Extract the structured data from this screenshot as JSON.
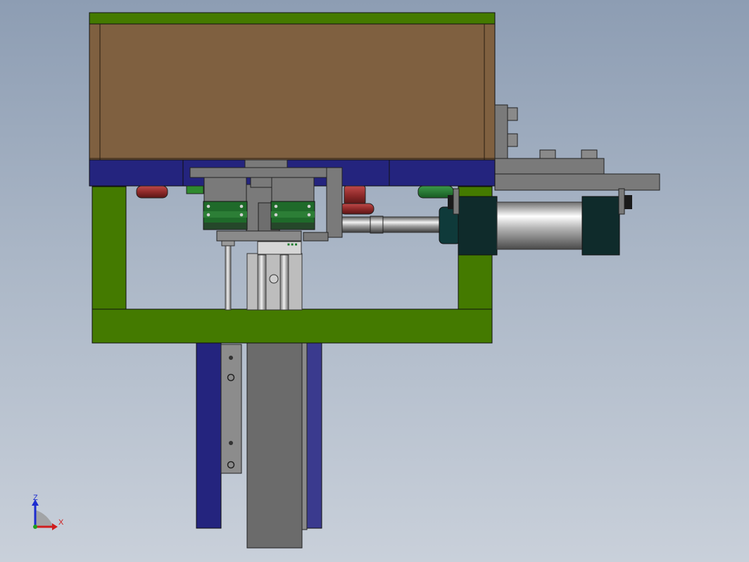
{
  "viewport": {
    "background_top": "#8d9db3",
    "background_bottom": "#c9d0da"
  },
  "colors": {
    "wood_plate": "#7f6040",
    "green_frame": "#447a00",
    "blue_plate": "#24247e",
    "gray_part": "#6b6b6b",
    "dark_teal": "#0f2b2b",
    "red_part": "#8f2a2a",
    "green_block": "#1f6a2a"
  },
  "triad": {
    "z_label": "Z",
    "x_label": "X",
    "z_color": "#1d2cd0",
    "x_color": "#d01d1d",
    "y_color": "#1da01d"
  }
}
